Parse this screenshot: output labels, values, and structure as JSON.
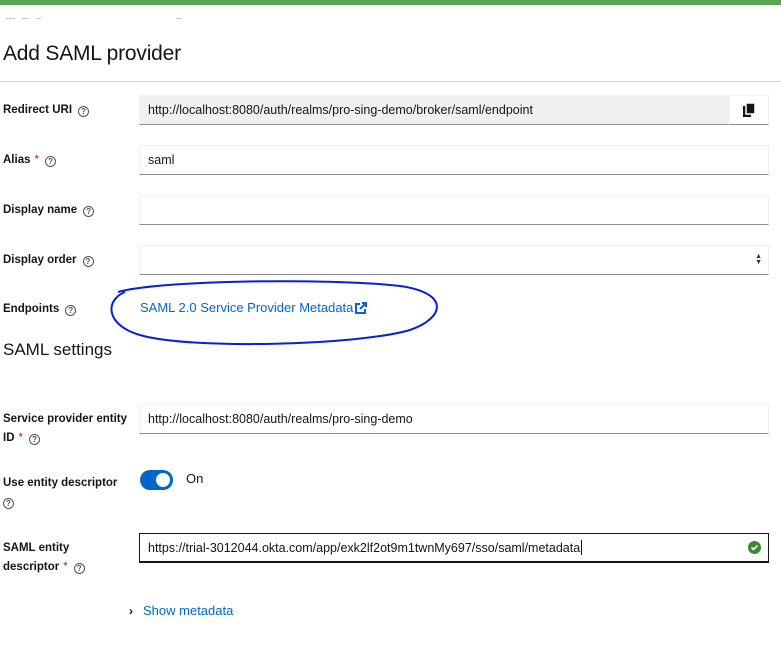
{
  "page": {
    "title": "Add SAML provider"
  },
  "fields": {
    "redirect_uri": {
      "label": "Redirect URI",
      "value": "http://localhost:8080/auth/realms/pro-sing-demo/broker/saml/endpoint"
    },
    "alias": {
      "label": "Alias",
      "required_mark": "*",
      "value": "saml"
    },
    "display_name": {
      "label": "Display name",
      "value": ""
    },
    "display_order": {
      "label": "Display order",
      "value": ""
    },
    "endpoints": {
      "label": "Endpoints",
      "link_text": "SAML 2.0 Service Provider Metadata"
    }
  },
  "saml_settings": {
    "title": "SAML settings",
    "sp_entity_id": {
      "label_line1": "Service provider entity",
      "label_line2": "ID",
      "required_mark": "*",
      "value": "http://localhost:8080/auth/realms/pro-sing-demo"
    },
    "use_entity_descriptor": {
      "label_line1": "Use entity descriptor",
      "state_text": "On",
      "checked": true
    },
    "saml_entity_descriptor": {
      "label_line1": "SAML entity",
      "label_line2": "descriptor",
      "required_mark": "*",
      "value": "https://trial-3012044.okta.com/app/exk2lf2ot9m1twnMy697/sso/saml/metadata"
    },
    "show_metadata": {
      "label": "Show metadata"
    }
  },
  "colors": {
    "accent_bar": "#5ba352",
    "link": "#0066cc",
    "switch_on": "#0066cc",
    "success": "#3e8635",
    "annotation_circle": "#0a1fd1"
  }
}
